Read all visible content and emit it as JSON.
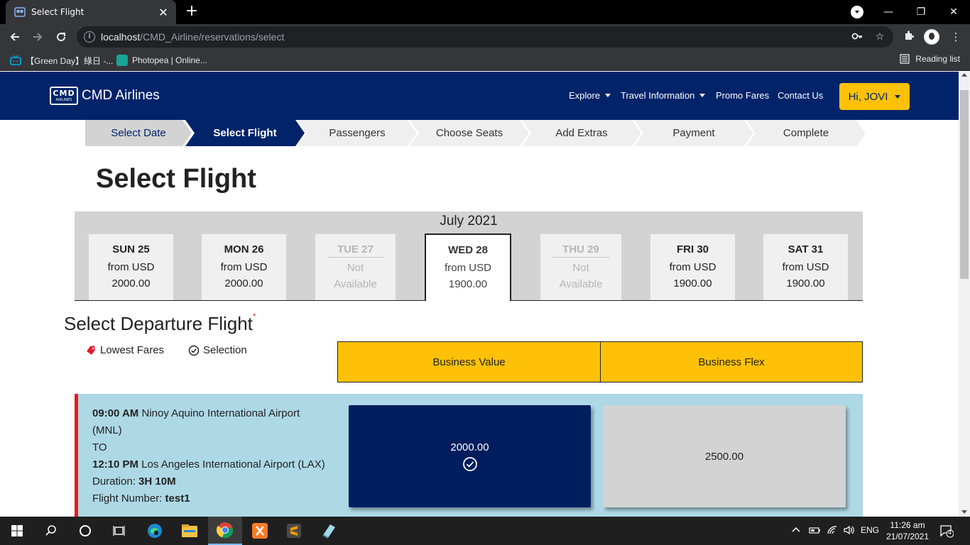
{
  "browser": {
    "tab_title": "Select Flight",
    "url_host": "localhost",
    "url_path": "/CMD_Airline/reservations/select",
    "bookmarks": [
      "【Green Day】綠日 -...",
      "Photopea | Online..."
    ],
    "reading_list": "Reading list"
  },
  "site": {
    "brand_logo_line1": "CMD",
    "brand_logo_line2": "AIRLINES",
    "brand_name": "CMD Airlines",
    "nav": [
      "Explore",
      "Travel Information",
      "Promo Fares",
      "Contact Us"
    ],
    "user_button": "Hi, JOVI"
  },
  "steps": [
    {
      "label": "Select Date",
      "state": "done"
    },
    {
      "label": "Select Flight",
      "state": "current"
    },
    {
      "label": "Passengers",
      "state": "todo"
    },
    {
      "label": "Choose Seats",
      "state": "todo"
    },
    {
      "label": "Add Extras",
      "state": "todo"
    },
    {
      "label": "Payment",
      "state": "todo"
    },
    {
      "label": "Complete",
      "state": "todo"
    }
  ],
  "page_title": "Select Flight",
  "month": "July 2021",
  "days": [
    {
      "name": "SUN 25",
      "line2": "from USD",
      "line3": "2000.00",
      "available": true,
      "selected": false
    },
    {
      "name": "MON 26",
      "line2": "from USD",
      "line3": "2000.00",
      "available": true,
      "selected": false
    },
    {
      "name": "TUE 27",
      "line2": "Not",
      "line3": "Available",
      "available": false,
      "selected": false
    },
    {
      "name": "WED 28",
      "line2": "from USD",
      "line3": "1900.00",
      "available": true,
      "selected": true
    },
    {
      "name": "THU 29",
      "line2": "Not",
      "line3": "Available",
      "available": false,
      "selected": false
    },
    {
      "name": "FRI 30",
      "line2": "from USD",
      "line3": "1900.00",
      "available": true,
      "selected": false
    },
    {
      "name": "SAT 31",
      "line2": "from USD",
      "line3": "1900.00",
      "available": true,
      "selected": false
    }
  ],
  "departure": {
    "title": "Select Departure Flight",
    "required_mark": "*",
    "legend_lowest": "Lowest Fares",
    "legend_selection": "Selection",
    "fare_classes": [
      "Business Value",
      "Business Flex"
    ]
  },
  "flight": {
    "dep_time": "09:00 AM",
    "dep_airport": "Ninoy Aquino International Airport",
    "dep_code": "(MNL)",
    "to": "TO",
    "arr_time": "12:10 PM",
    "arr_airport": "Los Angeles International Airport (LAX)",
    "duration_label": "Duration:",
    "duration": "3H 10M",
    "flight_number_label": "Flight Number:",
    "flight_number": "test1",
    "fares": [
      {
        "price": "2000.00",
        "selected": true
      },
      {
        "price": "2500.00",
        "selected": false
      }
    ]
  },
  "taskbar": {
    "lang": "ENG",
    "time": "11:26 am",
    "date": "21/07/2021",
    "notifications": "4"
  },
  "colors": {
    "navy": "#002369",
    "accent": "#ffc107",
    "flight_card": "#add8e6",
    "flight_marker": "#e8191c"
  }
}
